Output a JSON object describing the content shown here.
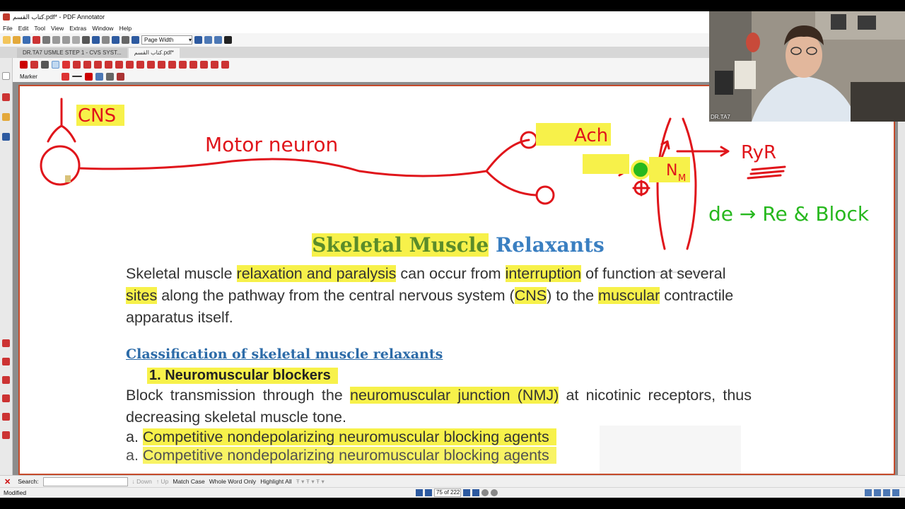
{
  "window": {
    "title": "كتاب القسم.pdf* - PDF Annotator"
  },
  "menu": [
    "File",
    "Edit",
    "Tool",
    "View",
    "Extras",
    "Window",
    "Help"
  ],
  "toolbar": {
    "zoom_value": "Page Width"
  },
  "tabs": [
    {
      "label": "DR.TA7 USMLE STEP 1 - CVS SYST...",
      "active": false
    },
    {
      "label": "كتاب القسم.pdf*",
      "active": true
    }
  ],
  "tool_name": "Marker",
  "colors": {
    "ink_red": "#e0151b",
    "ink_green": "#27b81e",
    "highlight": "#f7f14a",
    "page_border": "#c64a2a"
  },
  "annotations": {
    "cns": "CNS",
    "motor_neuron": "Motor neuron",
    "ach": "Ach",
    "nm": "N",
    "nm_sub": "M",
    "ryr": "RyR",
    "depol": "de → Re & Block"
  },
  "document": {
    "title_part1": "Skeletal Muscle",
    "title_part2": "Relaxants",
    "para1": {
      "t1": "Skeletal muscle ",
      "h1": "relaxation and paralysis",
      "t2": " can occur from ",
      "h2": "interruption",
      "t3": " of function at several ",
      "h3": "sites",
      "t4": " along the pathway from the central nervous system (",
      "h4": "CNS",
      "t5": ") to the ",
      "h5": "muscular",
      "t6": " contractile apparatus itself."
    },
    "classification": "Classification of skeletal muscle relaxants",
    "section1": "1.  Neuromuscular blockers",
    "para2": {
      "t1": "Block transmission through the ",
      "h1": "neuromuscular junction (NMJ)",
      "t2": " at nicotinic receptors, thus decreasing skeletal muscle tone."
    },
    "item_a_prefix": "a. ",
    "item_a": "Competitive nondepolarizing neuromuscular blocking agents"
  },
  "search": {
    "label": "Search:",
    "down": "Down",
    "up": "Up",
    "match_case": "Match Case",
    "whole_word": "Whole Word Only",
    "highlight_all": "Highlight All"
  },
  "status": {
    "text": "Modified",
    "page_indicator": "75 of 222"
  },
  "webcam": {
    "label": "DR.TA7"
  }
}
